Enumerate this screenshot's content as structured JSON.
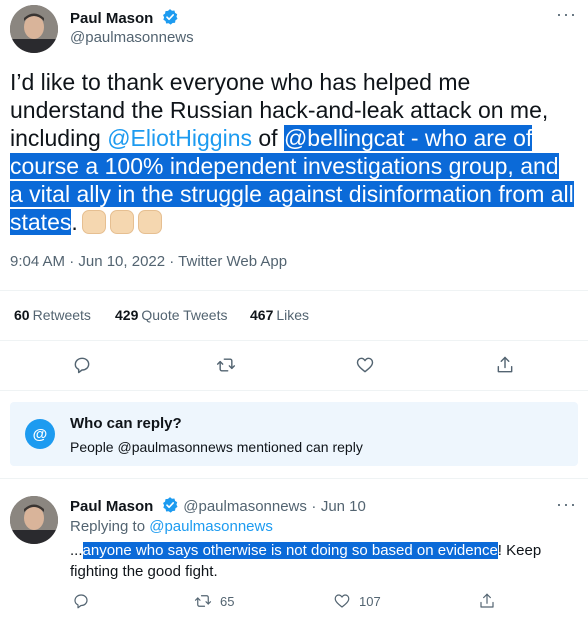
{
  "tweet": {
    "author_name": "Paul Mason",
    "author_handle": "@paulmasonnews",
    "text_part1": "I’d like to thank everyone who has helped me understand the Russian hack-and-leak attack on me, including ",
    "mention": "@EliotHiggins",
    "text_part2": " of ",
    "highlighted": " @bellingcat - who are of course a 100% independent investigations group, and a vital ally in the struggle against disinformation from all states",
    "text_end": ".",
    "timestamp": "9:04 AM · Jun 10, 2022 · Twitter Web App",
    "stats": {
      "retweets_count": "60",
      "retweets_label": "Retweets",
      "quotes_count": "429",
      "quotes_label": "Quote Tweets",
      "likes_count": "467",
      "likes_label": "Likes"
    },
    "actions": [
      "reply-icon",
      "retweet-icon",
      "like-icon",
      "share-icon"
    ]
  },
  "reply_settings": {
    "title": "Who can reply?",
    "subtitle": "People @paulmasonnews mentioned can reply",
    "badge": "@"
  },
  "reply": {
    "author_name": "Paul Mason",
    "author_handle": "@paulmasonnews",
    "separator": "·",
    "date": "Jun 10",
    "replying_to_label": "Replying to",
    "replying_to_handle": "@paulmasonnews",
    "text_prefix": "...",
    "highlighted": "anyone who says otherwise is not doing so based on evidence",
    "text_suffix": "! Keep fighting the good fight.",
    "retweet_count": "65",
    "like_count": "107"
  },
  "colors": {
    "accent": "#1d9bf0",
    "selection": "#0b6ad8",
    "secondary_text": "#536471"
  }
}
